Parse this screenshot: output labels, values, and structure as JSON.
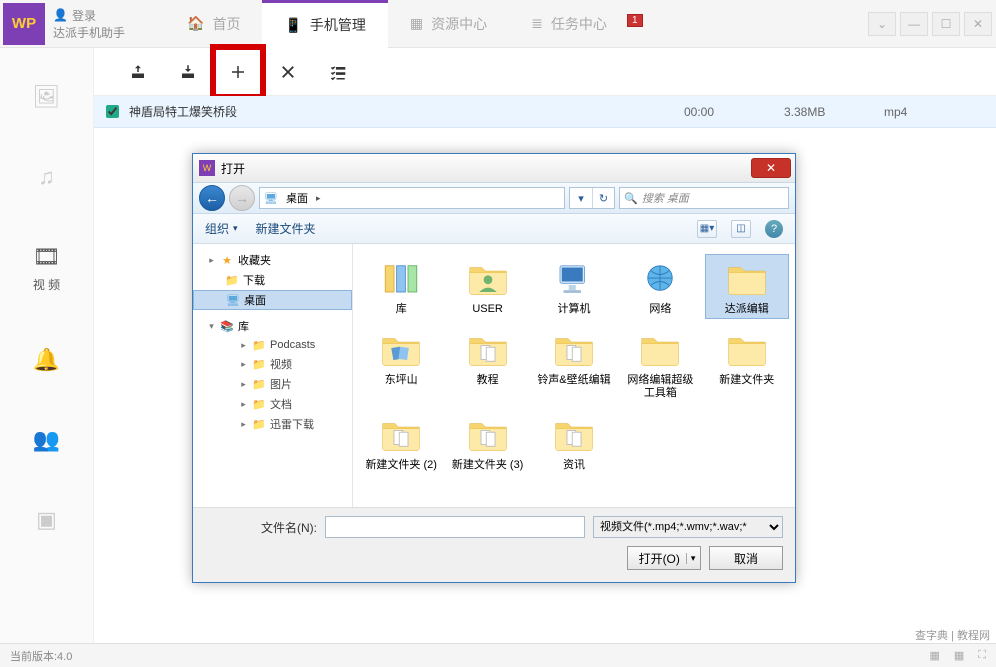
{
  "app": {
    "logo_text": "WP",
    "login": "登录",
    "subtitle": "达派手机助手"
  },
  "nav_tabs": {
    "home": "首页",
    "phone": "手机管理",
    "resource": "资源中心",
    "tasks": "任务中心"
  },
  "notif_badge": "1",
  "side_nav": {
    "video": "视 频"
  },
  "file_list": {
    "rows": [
      {
        "name": "神盾局特工爆笑桥段",
        "duration": "00:00",
        "size": "3.38MB",
        "format": "mp4",
        "checked": true
      }
    ]
  },
  "dialog": {
    "title": "打开",
    "path_root": "桌面",
    "search_placeholder": "搜索 桌面",
    "toolbar": {
      "organize": "组织",
      "newfolder": "新建文件夹"
    },
    "tree": {
      "favorites": "收藏夹",
      "downloads": "下载",
      "desktop": "桌面",
      "library": "库",
      "podcasts": "Podcasts",
      "videos": "视频",
      "pictures": "图片",
      "documents": "文档",
      "thunder": "迅雷下载"
    },
    "files": [
      {
        "name": "库",
        "kind": "library"
      },
      {
        "name": "USER",
        "kind": "user"
      },
      {
        "name": "计算机",
        "kind": "computer"
      },
      {
        "name": "网络",
        "kind": "network"
      },
      {
        "name": "达派编辑",
        "kind": "folder",
        "selected": true
      },
      {
        "name": "东坪山",
        "kind": "folder_photos"
      },
      {
        "name": "教程",
        "kind": "folder_docs"
      },
      {
        "name": "铃声&壁纸编辑",
        "kind": "folder_docs"
      },
      {
        "name": "网络编辑超级工具箱",
        "kind": "folder"
      },
      {
        "name": "新建文件夹",
        "kind": "folder"
      },
      {
        "name": "新建文件夹 (2)",
        "kind": "folder_docs"
      },
      {
        "name": "新建文件夹 (3)",
        "kind": "folder_docs"
      },
      {
        "name": "资讯",
        "kind": "folder_docs"
      }
    ],
    "filename_label": "文件名(N):",
    "filename_value": "",
    "filetype": "视频文件(*.mp4;*.wmv;*.wav;*",
    "open_btn": "打开(O)",
    "cancel_btn": "取消"
  },
  "statusbar": {
    "version": "当前版本:4.0"
  },
  "watermark": "查字典 | 教程网"
}
